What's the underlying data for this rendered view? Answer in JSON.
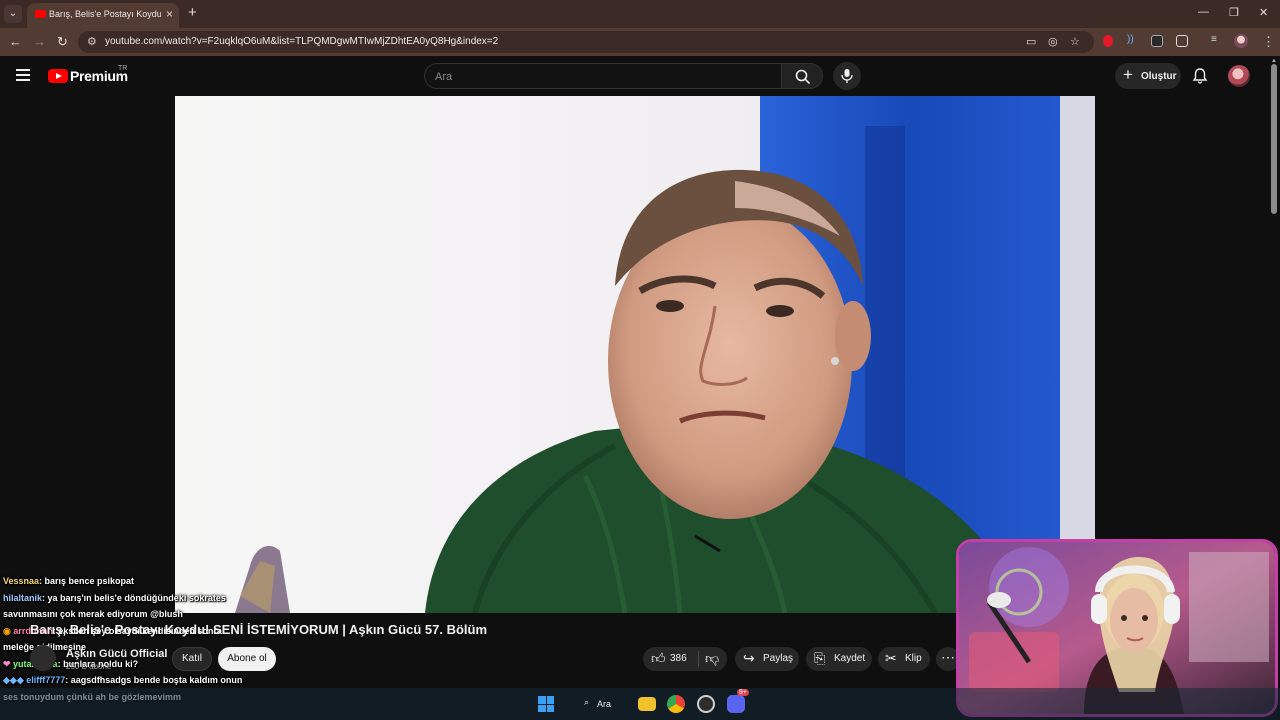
{
  "browser": {
    "tab_title": "Barış, Belis'e Postayı Koydu! SENİ",
    "url": "youtube.com/watch?v=F2uqklqO6uM&list=TLPQMDgwMTIwMjZDhtEA0yQ8Hg&index=2"
  },
  "header": {
    "logo_text": "Premium",
    "region": "TR",
    "search_placeholder": "Ara",
    "create_label": "Oluştur"
  },
  "video": {
    "title": "Barış, Belis'e Postayı Koydu! SENİ İSTEMİYORUM | Aşkın Gücü 57. Bölüm",
    "channel": "Aşkın Gücü Official",
    "subscribers": "250 B abone",
    "join_label": "Katıl",
    "subscribe_label": "Abone ol",
    "like_count": "386",
    "share_label": "Paylaş",
    "save_label": "Kaydet",
    "clip_label": "Klip"
  },
  "chat": [
    {
      "user": "Vessnaa",
      "user_color": "#f5d76e",
      "text": ": barış bence psikopat"
    },
    {
      "user": "hilaltanik",
      "user_color": "#9ec9ff",
      "text": ": ya barış'ın belis'e döndüğündeki sokrates savunmasını çok merak ediyorum @blush"
    },
    {
      "user": "arrdnnnn",
      "user_color": "#ff7fa8",
      "text": ": eksilen şey olsaydı kendisinden sonra meleğe gidilmesine"
    },
    {
      "user": "yutaleyuta",
      "user_color": "#7cff7c",
      "text": ": bunlara noldu ki?"
    },
    {
      "user": "elifff7777",
      "user_color": "#6fb7ff",
      "text": ": aagsdfhsadgs bende boşta kaldım onun ses tonuydum çünkü ah be gözlemevimm"
    }
  ],
  "taskbar": {
    "search_label": "Ara",
    "discord_badge": "9+"
  },
  "colors": {
    "browser_frame": "#3b2a25",
    "yt_red": "#ff0000",
    "background": "#0f0f0f",
    "cam_border": "#c53fa8"
  }
}
